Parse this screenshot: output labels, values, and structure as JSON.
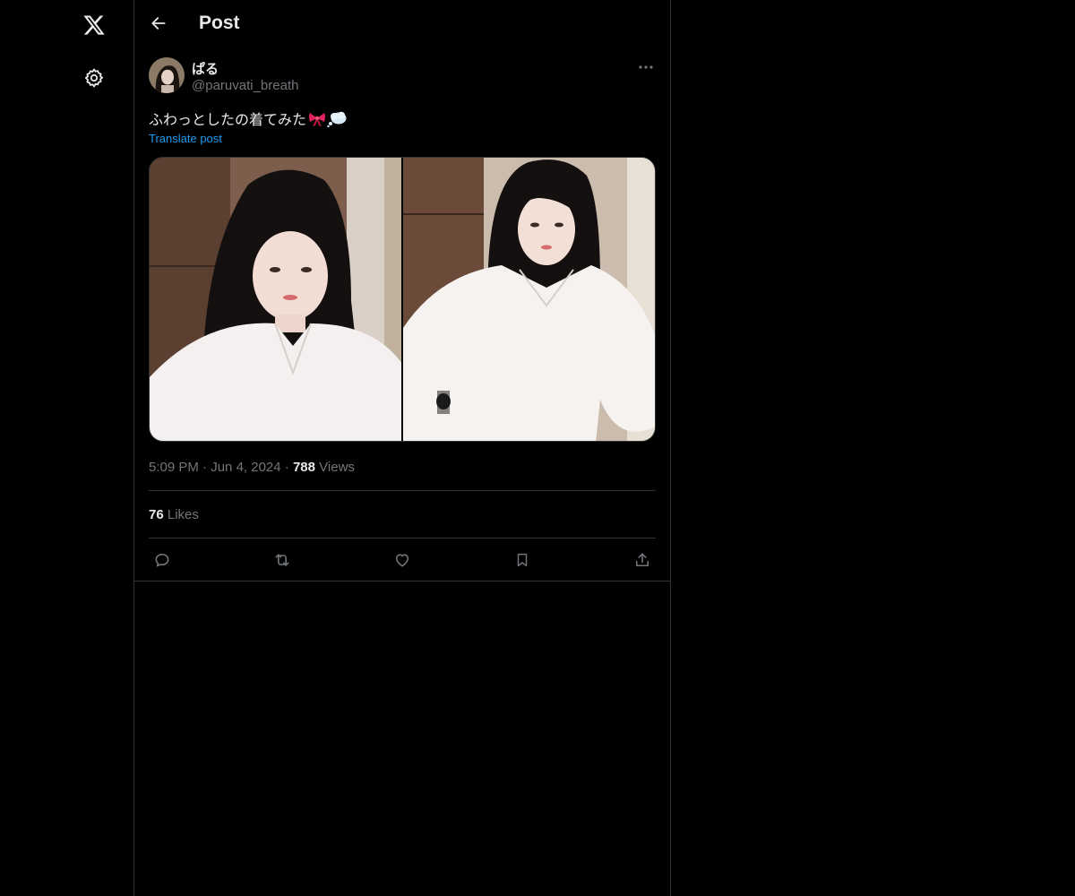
{
  "header": {
    "title": "Post"
  },
  "post": {
    "author_name": "ぱる",
    "author_handle": "@paruvati_breath",
    "text": "ふわっとしたの着てみた",
    "translate_label": "Translate post",
    "time": "5:09 PM",
    "date": "Jun 4, 2024",
    "views_count": "788",
    "views_label": "Views",
    "likes_count": "76",
    "likes_label": "Likes",
    "separator": "·",
    "emojis": [
      "ribbon-emoji",
      "thought-bubble-emoji"
    ],
    "media_count": 2
  },
  "icons": {
    "logo": "x-logo-icon",
    "settings": "gear-icon",
    "back": "back-arrow-icon",
    "more": "more-dots-icon",
    "actions": [
      "reply-icon",
      "repost-icon",
      "like-icon",
      "bookmark-icon",
      "share-icon"
    ]
  },
  "colors": {
    "background": "#000000",
    "text": "#e7e9ea",
    "secondary": "#71767b",
    "link": "#1d9bf0",
    "border": "#2f3336"
  }
}
